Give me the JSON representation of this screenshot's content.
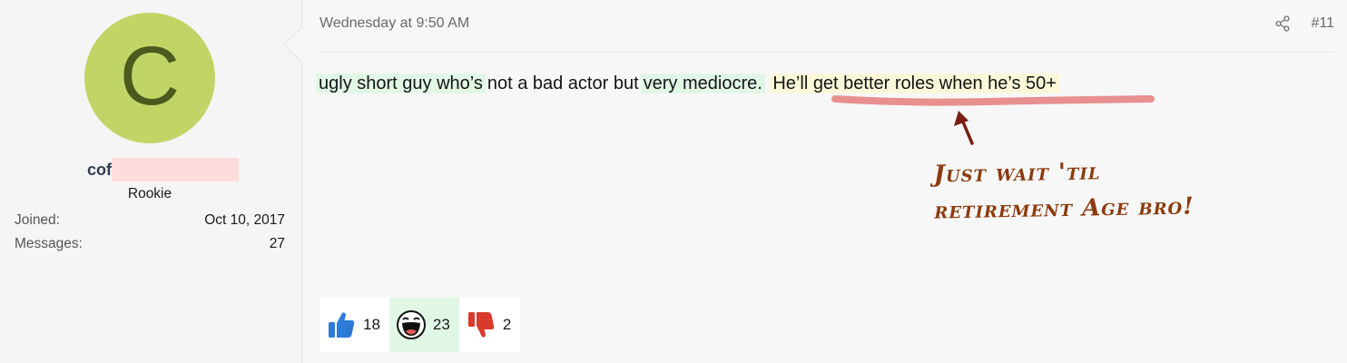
{
  "user": {
    "avatar_letter": "C",
    "name_visible": "cof",
    "title": "Rookie",
    "stats": [
      {
        "label": "Joined:",
        "value": "Oct 10, 2017"
      },
      {
        "label": "Messages:",
        "value": "27"
      }
    ]
  },
  "post": {
    "date": "Wednesday at 9:50 AM",
    "number": "#11",
    "segments": [
      {
        "text": "ugly short guy who’s",
        "style": "green"
      },
      {
        "text": "not a bad actor but",
        "style": "plain"
      },
      {
        "text": "very mediocre.",
        "style": "green"
      },
      {
        "text": "He’ll get better roles when he’s 50+",
        "style": "yellow"
      }
    ]
  },
  "annotation": {
    "line1": "Just wait 'til",
    "line2": "retirement Age bro!",
    "color": "#8c3a0c",
    "underline_color": "#e88f8f",
    "arrow_color": "#7a1e12"
  },
  "reactions": [
    {
      "icon": "thumbs-up-icon",
      "count": "18"
    },
    {
      "icon": "laughing-face-icon",
      "count": "23"
    },
    {
      "icon": "thumbs-down-icon",
      "count": "2"
    }
  ],
  "colors": {
    "avatar_bg": "#c1d567",
    "highlight_green": "#e1f7e6",
    "highlight_yellow": "#fcf7d9",
    "like_blue": "#2f7bd8",
    "dislike_red": "#d93a2a"
  }
}
